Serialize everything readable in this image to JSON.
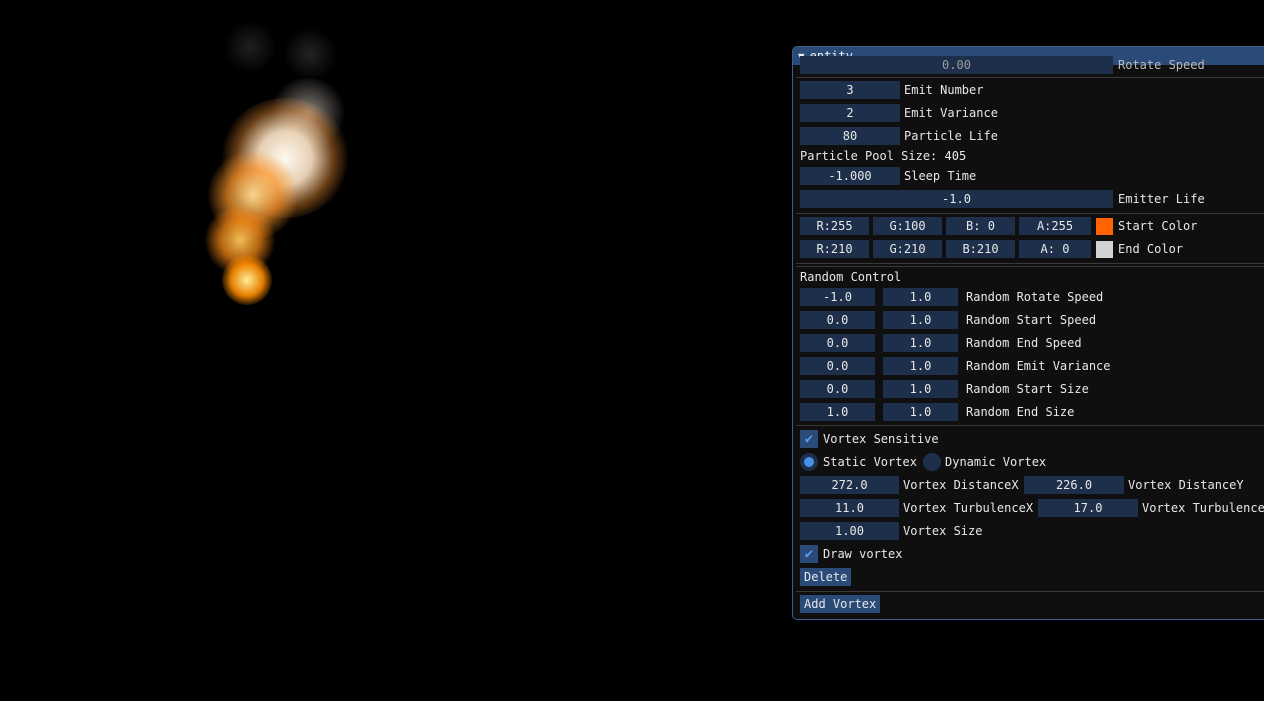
{
  "window": {
    "title": "entity",
    "collapse_glyph": "▼"
  },
  "top_partial": {
    "value": "0.00",
    "label": "Rotate Speed"
  },
  "emit": [
    {
      "value": "3",
      "label": "Emit Number"
    },
    {
      "value": "2",
      "label": "Emit Variance"
    },
    {
      "value": "80",
      "label": "Particle Life"
    }
  ],
  "pool_text": "Particle Pool Size: 405",
  "sleep": {
    "value": "-1.000",
    "label": "Sleep Time"
  },
  "emitter_life": {
    "value": "-1.0",
    "label": "Emitter Life"
  },
  "start_color": {
    "r": "R:255",
    "g": "G:100",
    "b": "B:  0",
    "a": "A:255",
    "label": "Start Color",
    "swatch": "#ff6400"
  },
  "end_color": {
    "r": "R:210",
    "g": "G:210",
    "b": "B:210",
    "a": "A:  0",
    "label": "End Color",
    "swatch": "#d2d2d2"
  },
  "random_header": "Random Control",
  "random": [
    {
      "min": "-1.0",
      "max": "1.0",
      "label": "Random Rotate Speed"
    },
    {
      "min": "0.0",
      "max": "1.0",
      "label": "Random Start Speed"
    },
    {
      "min": "0.0",
      "max": "1.0",
      "label": "Random End Speed"
    },
    {
      "min": "0.0",
      "max": "1.0",
      "label": "Random Emit Variance"
    },
    {
      "min": "0.0",
      "max": "1.0",
      "label": "Random Start Size"
    },
    {
      "min": "1.0",
      "max": "1.0",
      "label": "Random End Size"
    }
  ],
  "vortex_sensitive": {
    "checked": true,
    "label": "Vortex Sensitive"
  },
  "vortex_mode": {
    "static_label": "Static Vortex",
    "dynamic_label": "Dynamic Vortex",
    "selected": "static"
  },
  "vortex_distance": {
    "x": "272.0",
    "x_label": "Vortex DistanceX",
    "y": "226.0",
    "y_label": "Vortex DistanceY"
  },
  "vortex_turbulence": {
    "x": "11.0",
    "x_label": "Vortex TurbulenceX",
    "y": "17.0",
    "y_label": "Vortex Turbulence"
  },
  "vortex_size": {
    "value": "1.00",
    "label": "Vortex Size"
  },
  "draw_vortex": {
    "checked": true,
    "label": "Draw vortex"
  },
  "delete_label": "Delete",
  "add_vortex_label": "Add Vortex",
  "check_glyph": "✔"
}
